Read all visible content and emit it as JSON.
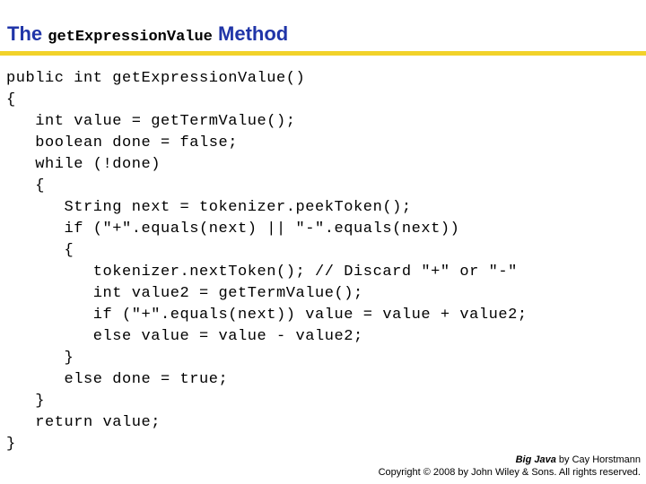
{
  "slide": {
    "title": {
      "lead": "The",
      "mono": "get",
      "mono_full": "getExpressionValue",
      "trail": "Method"
    },
    "accent_color": "#F2D22A",
    "title_color": "#2035A8",
    "code_color": "#000000",
    "background_color": "#FFFFFF"
  },
  "code": {
    "language": "java",
    "lines": [
      "public int getExpressionValue()",
      "{",
      "   int value = getTermValue();",
      "   boolean done = false;",
      "   while (!done)",
      "   {",
      "      String next = tokenizer.peekToken();",
      "      if (\"+\".equals(next) || \"-\".equals(next))",
      "      {",
      "         tokenizer.nextToken(); // Discard \"+\" or \"-\"",
      "         int value2 = getTermValue();",
      "         if (\"+\".equals(next)) value = value + value2;",
      "         else value = value - value2;",
      "      }",
      "      else done = true;",
      "   }",
      "   return value;",
      "}"
    ]
  },
  "footer": {
    "book_title": "Big Java",
    "book_credit": " by Cay Horstmann",
    "copyright": "Copyright © 2008 by John Wiley & Sons.  All rights reserved."
  }
}
